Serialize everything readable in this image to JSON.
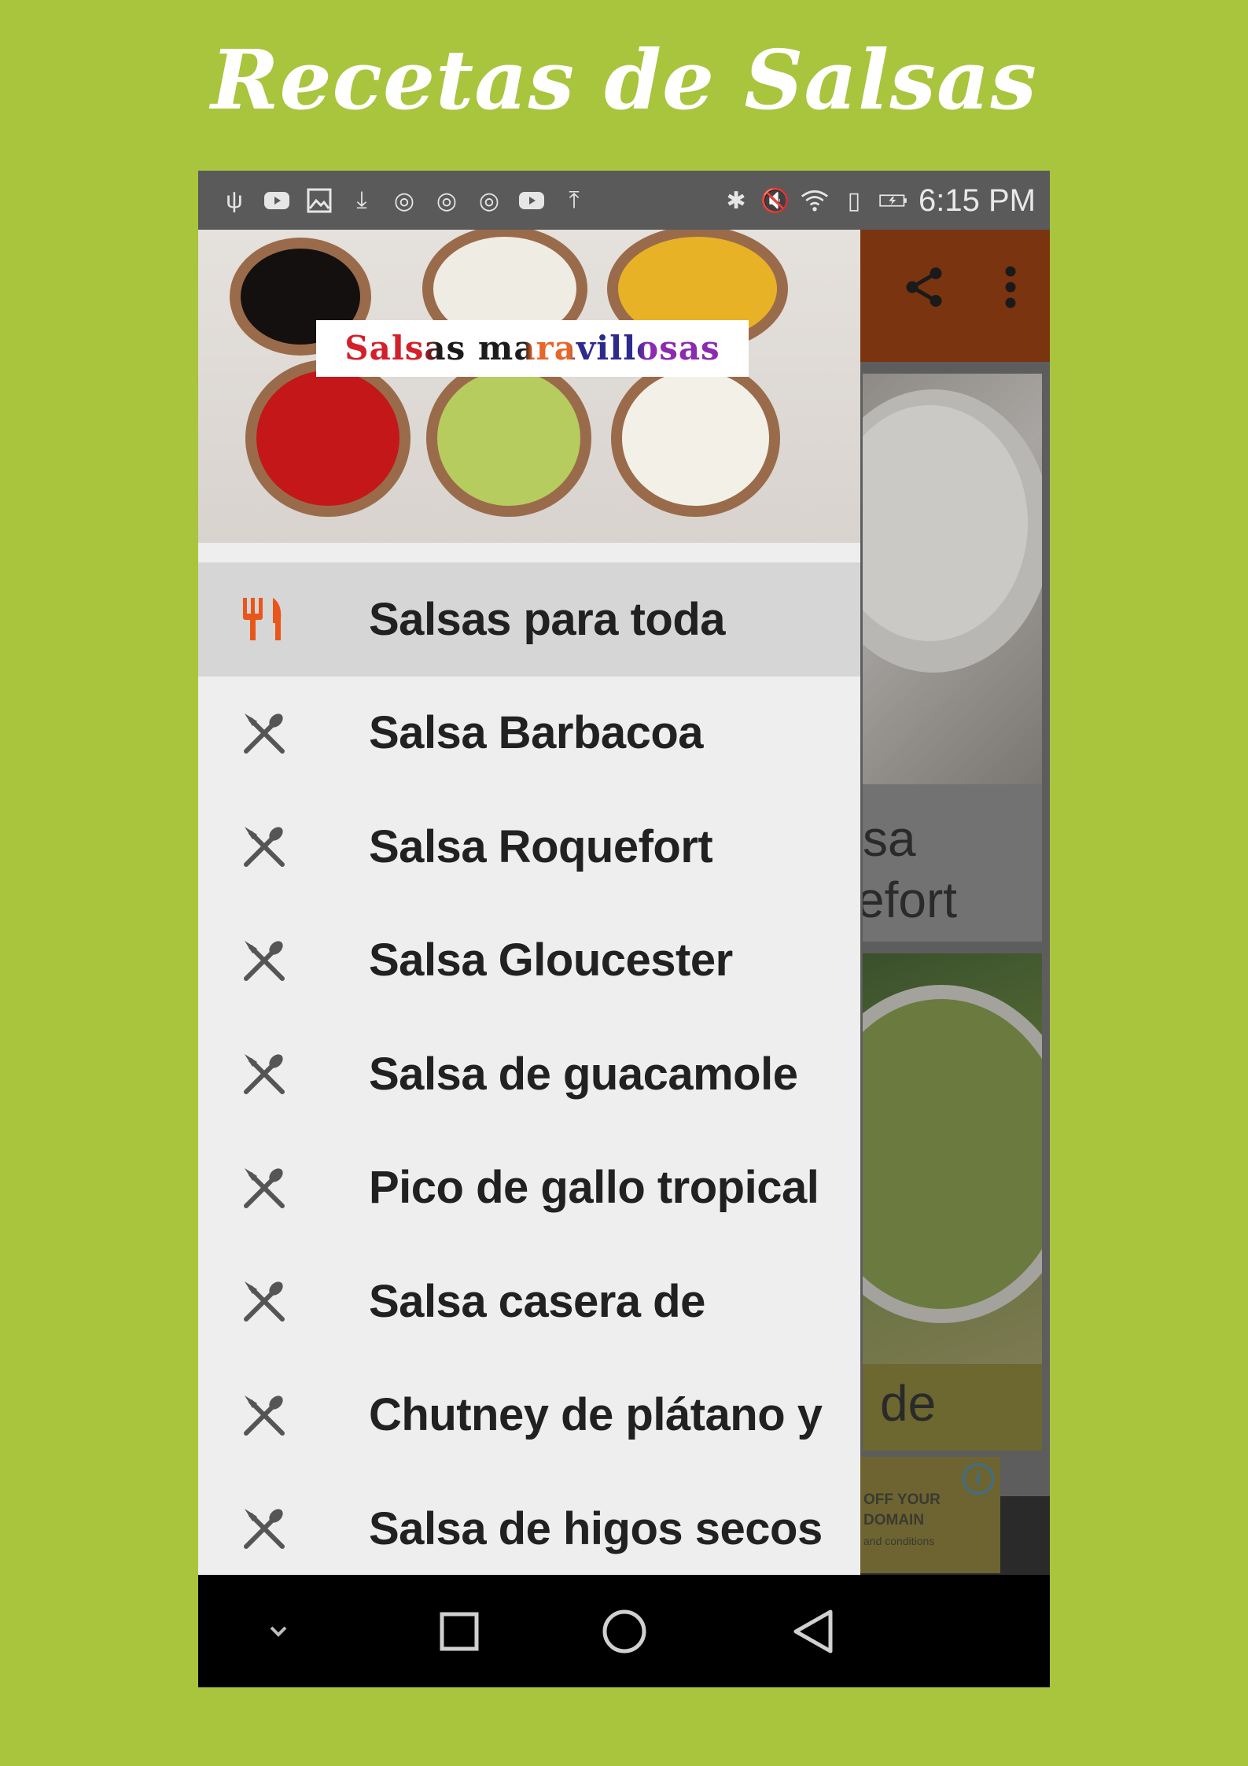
{
  "promo": {
    "title": "Recetas de Salsas"
  },
  "status_bar": {
    "time": "6:15 PM"
  },
  "drawer": {
    "header_text": "Salsas maravillosas",
    "items": [
      {
        "label": "Salsas para toda",
        "icon": "fork-knife-icon",
        "active": true
      },
      {
        "label": "Salsa Barbacoa",
        "icon": "spoon-knife-icon"
      },
      {
        "label": "Salsa Roquefort",
        "icon": "spoon-knife-icon"
      },
      {
        "label": "Salsa Gloucester",
        "icon": "spoon-knife-icon"
      },
      {
        "label": "Salsa de guacamole",
        "icon": "spoon-knife-icon"
      },
      {
        "label": "Pico de gallo tropical",
        "icon": "spoon-knife-icon"
      },
      {
        "label": "Salsa casera de",
        "icon": "spoon-knife-icon"
      },
      {
        "label": "Chutney de plátano y",
        "icon": "spoon-knife-icon"
      },
      {
        "label": "Salsa de higos secos",
        "icon": "spoon-knife-icon"
      }
    ]
  },
  "background": {
    "card1_title_line1": "sa",
    "card1_title_line2": "efort",
    "card2_title": "de",
    "ad_line1": "OFF YOUR",
    "ad_line2": "DOMAIN",
    "ad_line3": "and conditions"
  },
  "colors": {
    "page_background": "#a9c43d",
    "app_bar": "#7a3410",
    "active_icon": "#e8561a",
    "drawer_background": "#eeeeee"
  }
}
